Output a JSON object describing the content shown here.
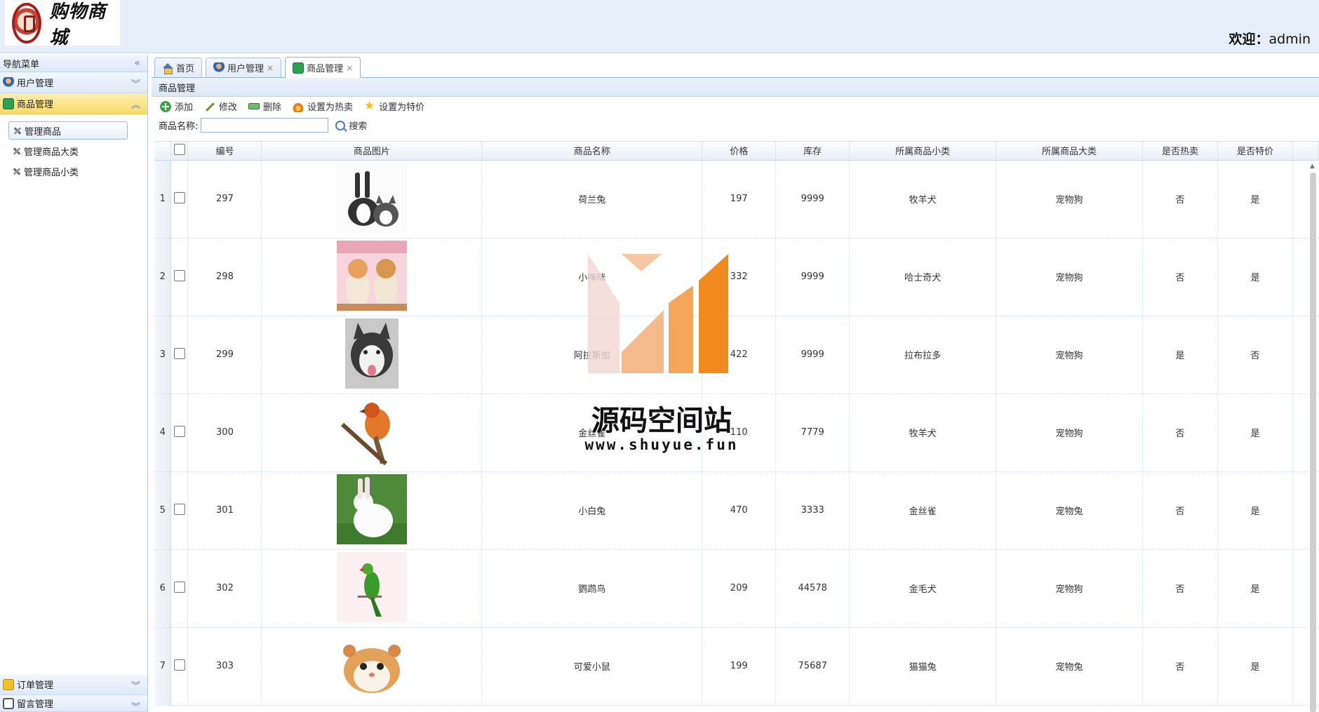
{
  "header": {
    "logo_text": "购物商城",
    "welcome_label": "欢迎：",
    "welcome_user": "admin"
  },
  "nav": {
    "title": "导航菜单",
    "panels": [
      {
        "label": "用户管理"
      },
      {
        "label": "商品管理",
        "items": [
          "管理商品",
          "管理商品大类",
          "管理商品小类"
        ]
      },
      {
        "label": "订单管理"
      },
      {
        "label": "留言管理"
      }
    ]
  },
  "tabs": [
    {
      "label": "首页"
    },
    {
      "label": "用户管理"
    },
    {
      "label": "商品管理"
    }
  ],
  "panel_title": "商品管理",
  "toolbar": {
    "add": "添加",
    "edit": "修改",
    "delete": "删除",
    "set_hot": "设置为热卖",
    "set_special": "设置为特价"
  },
  "search": {
    "label": "商品名称:",
    "value": "",
    "button": "搜索"
  },
  "table": {
    "columns": [
      "编号",
      "商品图片",
      "商品名称",
      "价格",
      "库存",
      "所属商品小类",
      "所属商品大类",
      "是否热卖",
      "是否特价"
    ],
    "rows": [
      {
        "n": "1",
        "id": "297",
        "name": "荷兰兔",
        "price": "197",
        "stock": "9999",
        "sub": "牧羊犬",
        "cat": "宠物狗",
        "hot": "否",
        "special": "是",
        "img": "rabbit-cat"
      },
      {
        "n": "2",
        "id": "298",
        "name": "小咪咪",
        "price": "332",
        "stock": "9999",
        "sub": "哈士奇犬",
        "cat": "宠物狗",
        "hot": "否",
        "special": "是",
        "img": "kittens"
      },
      {
        "n": "3",
        "id": "299",
        "name": "阿拉斯加",
        "price": "422",
        "stock": "9999",
        "sub": "拉布拉多",
        "cat": "宠物狗",
        "hot": "是",
        "special": "否",
        "img": "husky"
      },
      {
        "n": "4",
        "id": "300",
        "name": "金丝雀",
        "price": "110",
        "stock": "7779",
        "sub": "牧羊犬",
        "cat": "宠物狗",
        "hot": "否",
        "special": "是",
        "img": "canary"
      },
      {
        "n": "5",
        "id": "301",
        "name": "小白兔",
        "price": "470",
        "stock": "3333",
        "sub": "金丝雀",
        "cat": "宠物兔",
        "hot": "否",
        "special": "是",
        "img": "white-rabbit"
      },
      {
        "n": "6",
        "id": "302",
        "name": "鹦鹉鸟",
        "price": "209",
        "stock": "44578",
        "sub": "金毛犬",
        "cat": "宠物狗",
        "hot": "否",
        "special": "是",
        "img": "parrot"
      },
      {
        "n": "7",
        "id": "303",
        "name": "可爱小鼠",
        "price": "199",
        "stock": "75687",
        "sub": "猫猫兔",
        "cat": "宠物兔",
        "hot": "否",
        "special": "是",
        "img": "hamster"
      }
    ]
  },
  "watermark": {
    "title": "源码空间站",
    "url": "www.shuyue.fun"
  }
}
